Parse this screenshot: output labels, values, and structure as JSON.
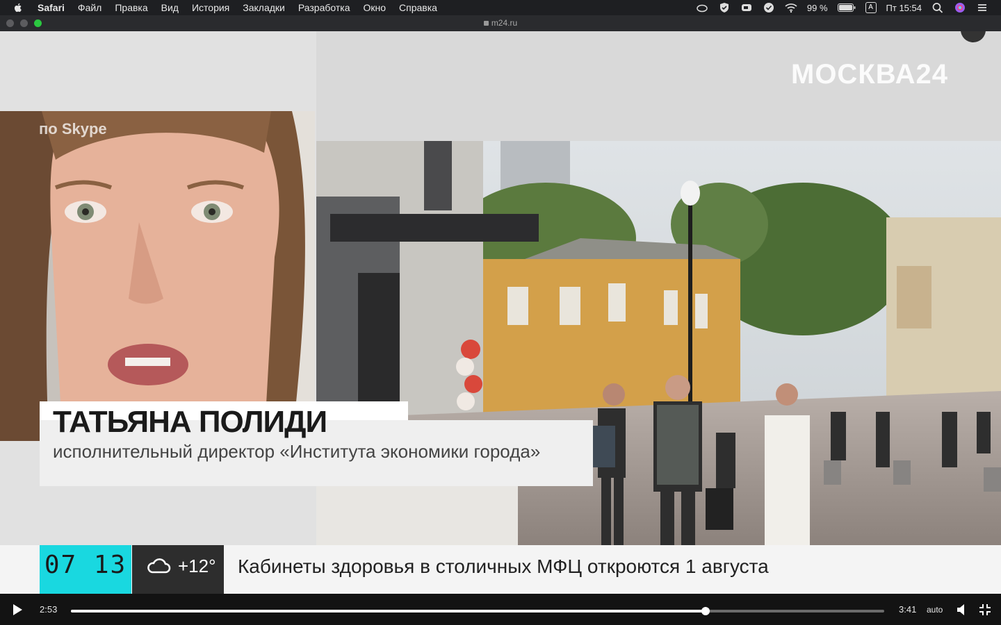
{
  "menubar": {
    "app": "Safari",
    "items": [
      "Файл",
      "Правка",
      "Вид",
      "История",
      "Закладки",
      "Разработка",
      "Окно",
      "Справка"
    ],
    "battery": "99 %",
    "input_source": "A",
    "clock": "Пт 15:54"
  },
  "browser": {
    "url": "m24.ru"
  },
  "video": {
    "channel_logo": "МОСКВА24",
    "skype_label": "по Skype",
    "speaker_name": "ТАТЬЯНА ПОЛИДИ",
    "speaker_title": "исполнительный директор «Института экономики города»",
    "ticker": {
      "clock": "07 13",
      "temperature": "+12°",
      "headline": "Кабинеты здоровья в столичных МФЦ откроются 1 августа"
    }
  },
  "player": {
    "current_time": "2:53",
    "total_time": "3:41",
    "progress": 0.78,
    "quality": "auto"
  },
  "colors": {
    "ticker_clock_bg": "#19d8e0",
    "ticker_weather_bg": "#2d2d2d",
    "player_bg": "#131313"
  }
}
